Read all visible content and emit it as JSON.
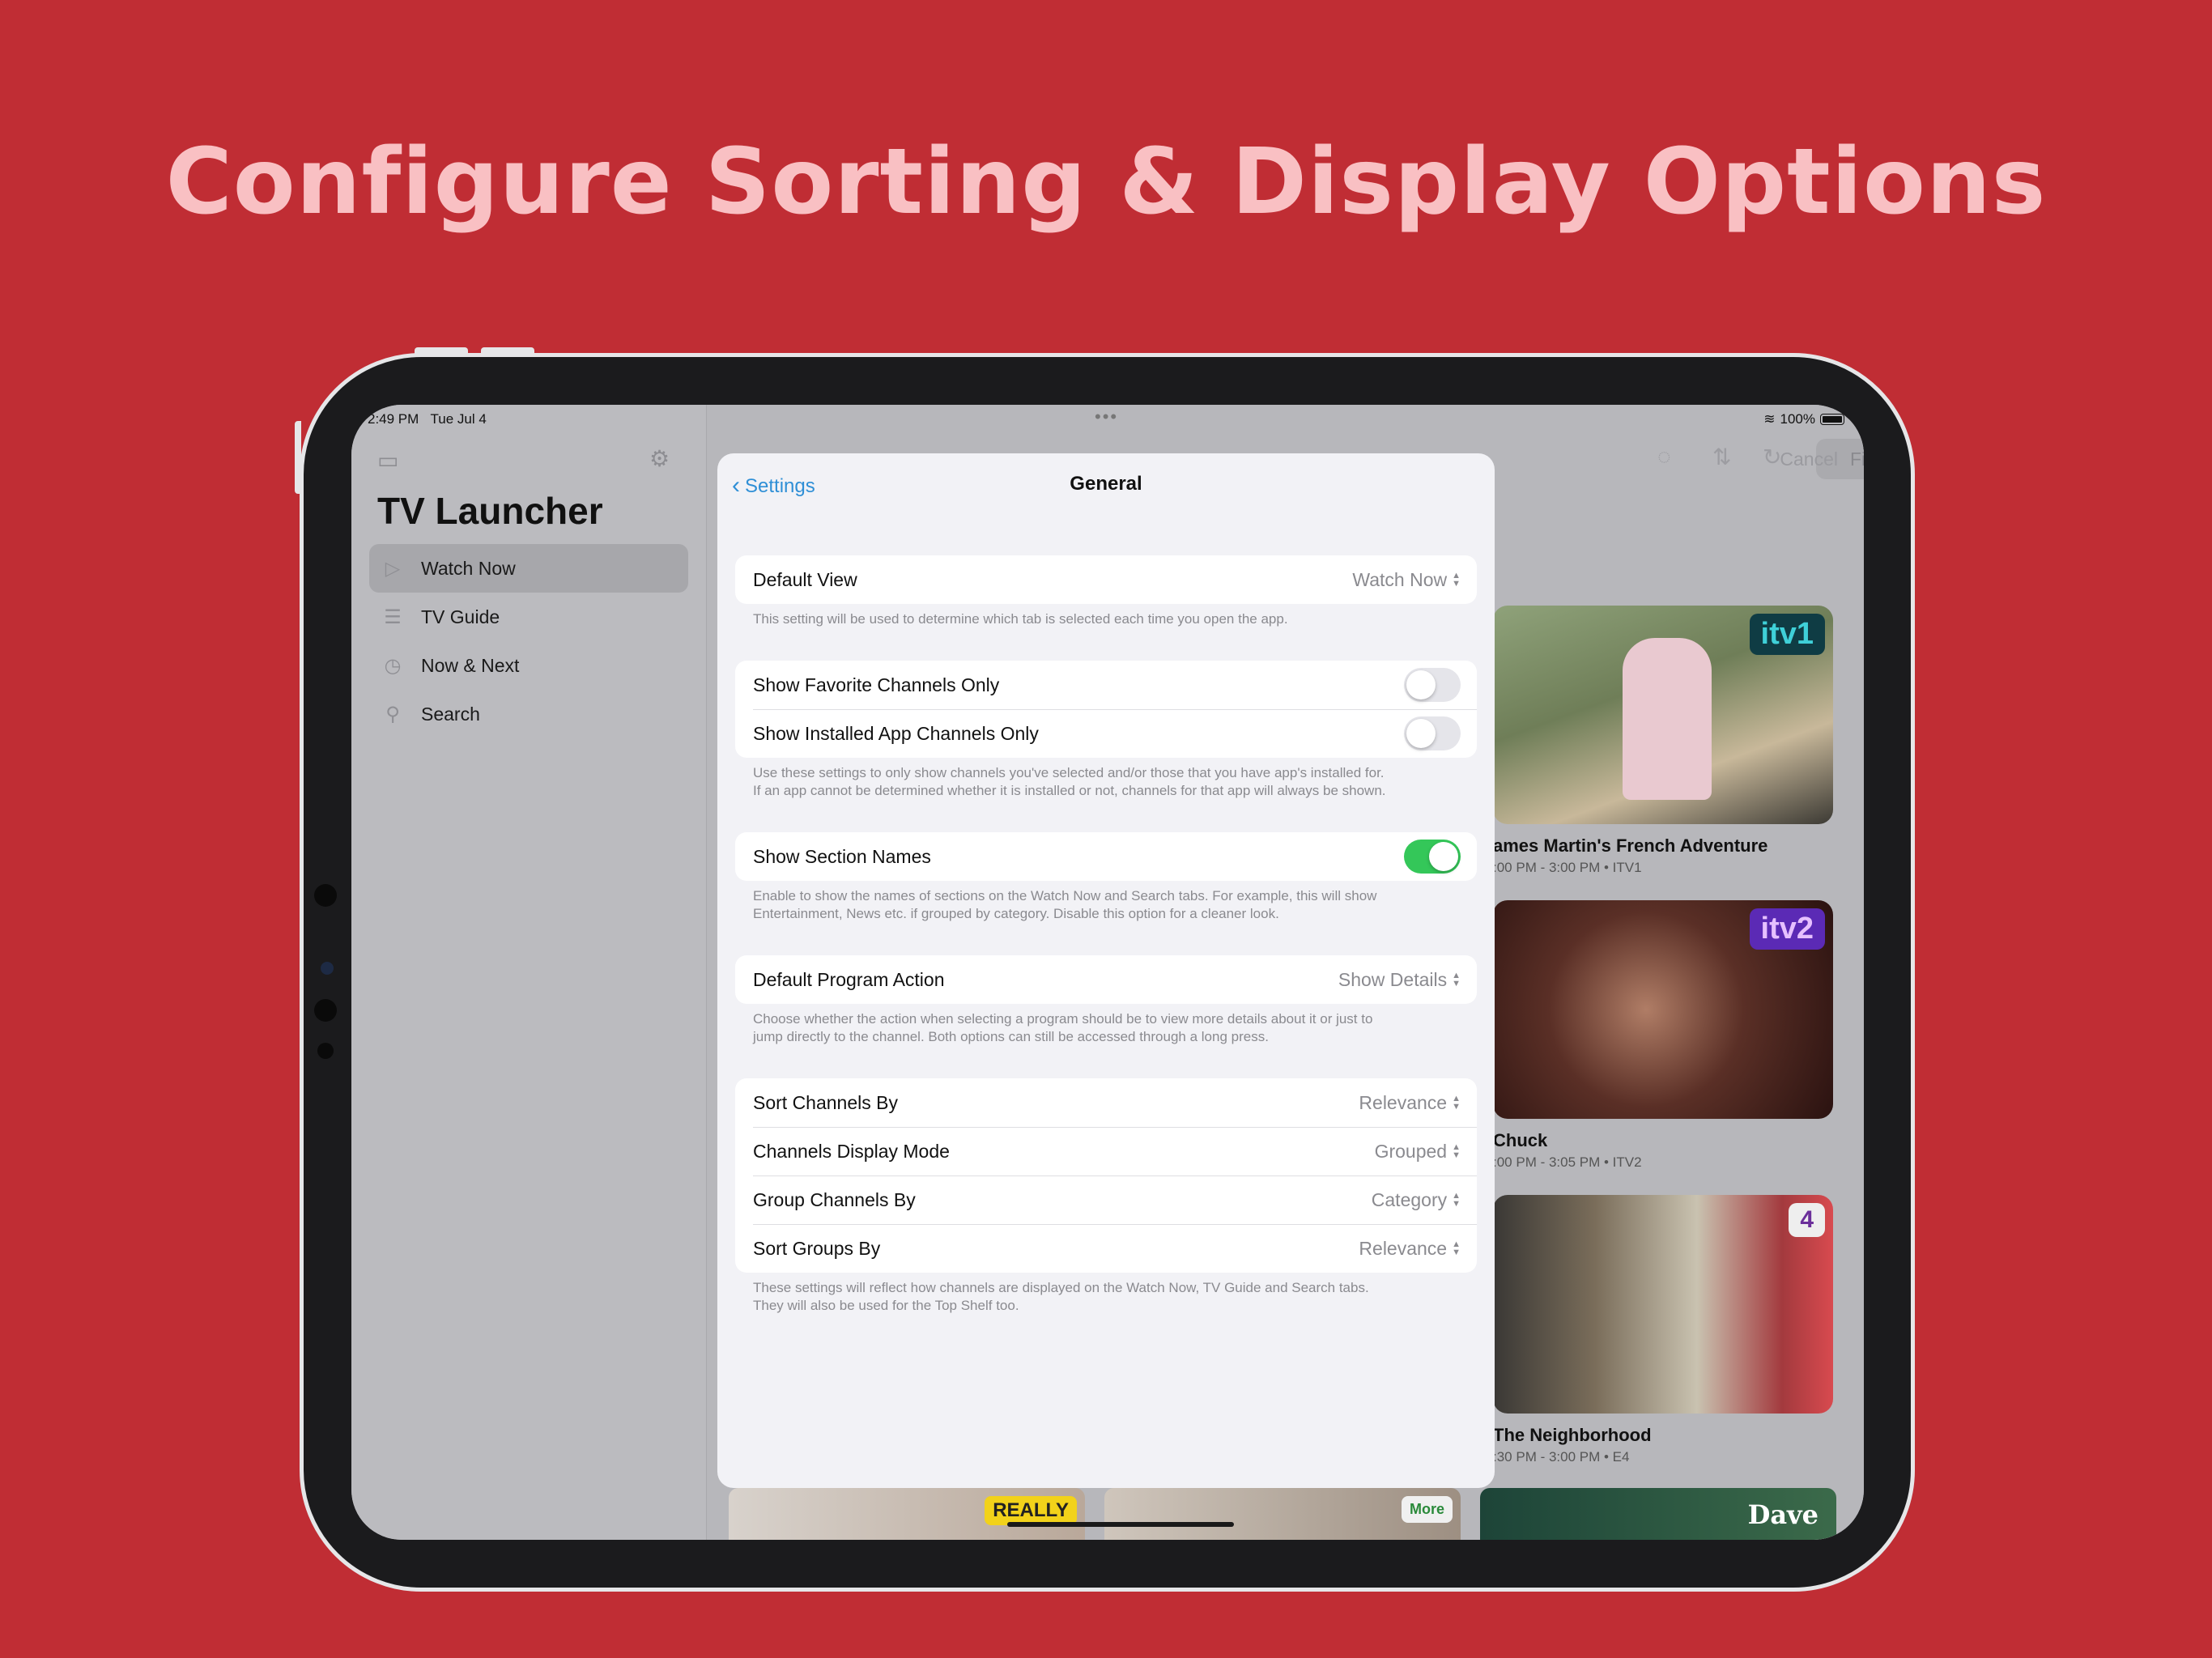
{
  "headline": "Configure Sorting & Display Options",
  "status": {
    "time": "2:49 PM",
    "date": "Tue Jul 4",
    "battery": "100%"
  },
  "sidebar": {
    "app_title": "TV Launcher",
    "items": [
      {
        "label": "Watch Now",
        "icon": "play-circle-icon",
        "active": true
      },
      {
        "label": "TV Guide",
        "icon": "guide-icon"
      },
      {
        "label": "Now & Next",
        "icon": "clock-icon"
      },
      {
        "label": "Search",
        "icon": "search-icon"
      }
    ]
  },
  "toolbar": {
    "filter_placeholder": "Filter Channels",
    "cancel_label": "Cancel"
  },
  "programs": [
    {
      "title": "ames Martin's French Adventure",
      "subtitle": ":00 PM - 3:00 PM • ITV1",
      "channel_logo": "itv1"
    },
    {
      "title": "Chuck",
      "subtitle": ":00 PM - 3:05 PM • ITV2",
      "channel_logo": "itv2"
    },
    {
      "title": "The Neighborhood",
      "subtitle": ":30 PM - 3:00 PM • E4",
      "channel_logo": "4"
    }
  ],
  "bottom_row": {
    "logos": [
      "REALLY",
      "More",
      "Dave"
    ]
  },
  "settings": {
    "back_label": "Settings",
    "title": "General",
    "default_view": {
      "label": "Default View",
      "value": "Watch Now"
    },
    "default_view_footer": "This setting will be used to determine which tab is selected each time you open the app.",
    "show_favorites": {
      "label": "Show Favorite Channels Only",
      "on": false
    },
    "show_installed": {
      "label": "Show Installed App Channels Only",
      "on": false
    },
    "filter_footer_1": "Use these settings to only show channels you've selected and/or those that you have app's installed for.",
    "filter_footer_2": "If an app cannot be determined whether it is installed or not, channels for that app will always be shown.",
    "show_section_names": {
      "label": "Show Section Names",
      "on": true
    },
    "section_footer_1": "Enable to show the names of sections on the Watch Now and Search tabs. For example, this will show",
    "section_footer_2": "Entertainment, News etc. if grouped by category. Disable this option for a cleaner look.",
    "default_action": {
      "label": "Default Program Action",
      "value": "Show Details"
    },
    "action_footer_1": "Choose whether the action when selecting a program should be to view more details about it or just to",
    "action_footer_2": "jump directly to the channel. Both options can still be accessed through a long press.",
    "sort_channels": {
      "label": "Sort Channels By",
      "value": "Relevance"
    },
    "display_mode": {
      "label": "Channels Display Mode",
      "value": "Grouped"
    },
    "group_by": {
      "label": "Group Channels By",
      "value": "Category"
    },
    "sort_groups": {
      "label": "Sort Groups By",
      "value": "Relevance"
    },
    "sort_footer_1": "These settings will reflect how channels are displayed on the Watch Now, TV Guide and Search tabs.",
    "sort_footer_2": "They will also be used for the Top Shelf too."
  },
  "colors": {
    "background": "#c02d34",
    "headline": "#f9c0c3",
    "accent": "#2f8fd6",
    "toggle_on": "#34c759"
  }
}
